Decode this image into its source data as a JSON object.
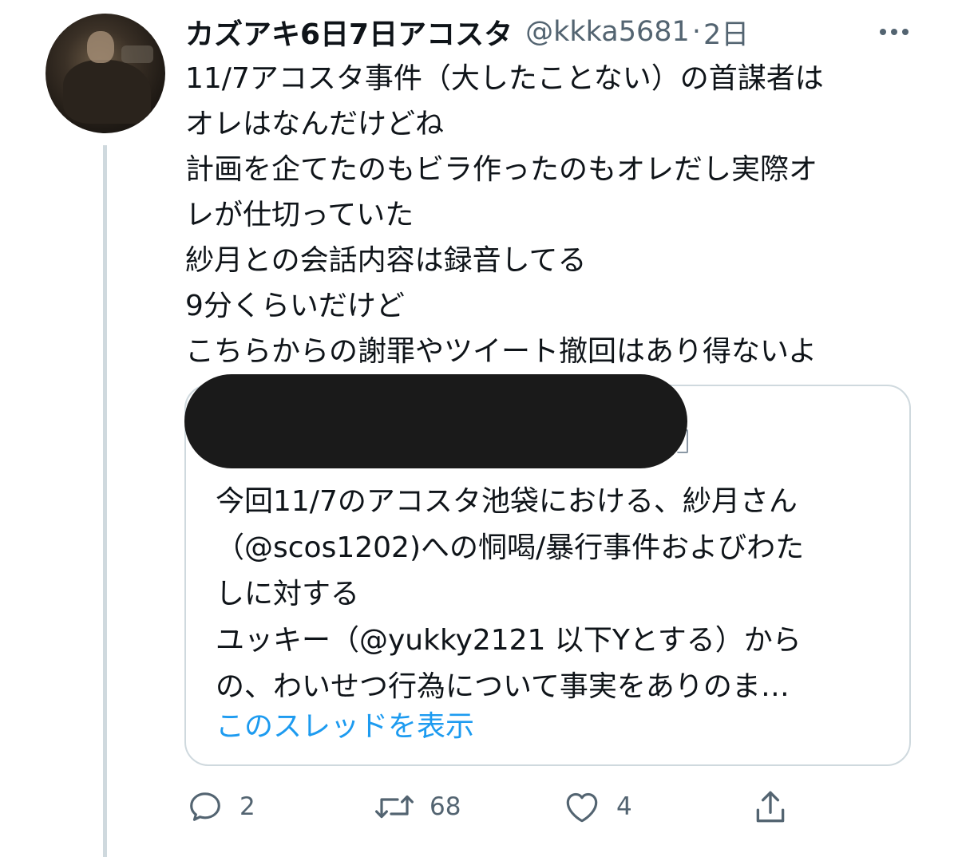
{
  "tweet": {
    "display_name": "カズアキ6日7日アコスタ",
    "handle": "@kkka5681",
    "separator": "·",
    "time": "2日",
    "lines": [
      "11/7アコスタ事件（大したことない）の首謀者は",
      "オレはなんだけどね",
      "計画を企てたのもビラ作ったのもオレだし実際オ",
      "レが仕切っていた",
      "紗月との会話内容は録音してる",
      "9分くらいだけど",
      "こちらからの謝罪やツイート撤回はあり得ないよ"
    ]
  },
  "quote": {
    "lines": [
      "今回11/7のアコスタ池袋における、紗月さん",
      "（@scos1202)への恫喝/暴行事件およびわた",
      "しに対する",
      "ユッキー（@yukky2121 以下Yとする）から",
      "の、わいせつ行為について事実をありのま…"
    ],
    "show_thread": "このスレッドを表示"
  },
  "actions": {
    "reply": {
      "icon": "reply-icon",
      "count": "2"
    },
    "retweet": {
      "icon": "retweet-icon",
      "count": "68"
    },
    "like": {
      "icon": "heart-icon",
      "count": "4"
    },
    "share": {
      "icon": "share-icon"
    }
  },
  "colors": {
    "text": "#0f1419",
    "secondary": "#536471",
    "link": "#1d9bf0",
    "border": "#cfd9de"
  }
}
